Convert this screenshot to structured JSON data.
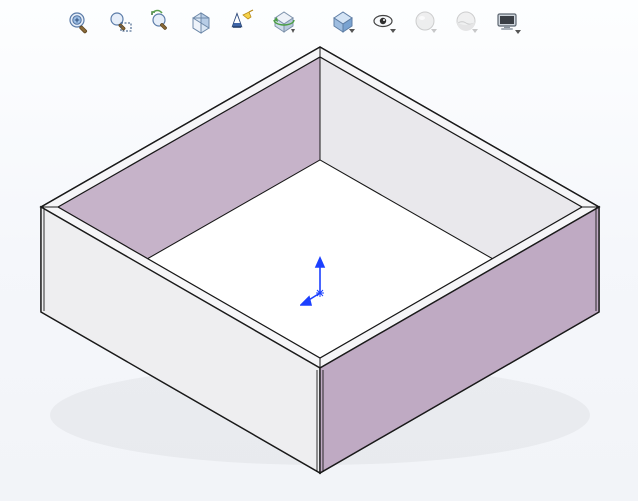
{
  "app": "CAD Viewer",
  "toolbar": {
    "items": [
      {
        "name": "zoom-to-fit-icon",
        "interactable": true,
        "tip": "Zoom to Fit"
      },
      {
        "name": "zoom-to-area-icon",
        "interactable": true,
        "tip": "Zoom to Area"
      },
      {
        "name": "previous-view-icon",
        "interactable": true,
        "tip": "Previous View"
      },
      {
        "name": "section-view-icon",
        "interactable": true,
        "tip": "Section View"
      },
      {
        "name": "dynamic-annotation-views-icon",
        "interactable": true,
        "tip": "Dynamic Annotation Views"
      },
      {
        "name": "view-orientation-icon",
        "interactable": true,
        "tip": "View Orientation"
      },
      {
        "name": "display-style-icon",
        "interactable": true,
        "tip": "Display Style"
      },
      {
        "name": "hide-show-items-icon",
        "interactable": true,
        "tip": "Hide/Show Items"
      },
      {
        "name": "edit-appearance-icon",
        "interactable": false,
        "tip": "Edit Appearance"
      },
      {
        "name": "apply-scene-icon",
        "interactable": false,
        "tip": "Apply Scene"
      },
      {
        "name": "view-settings-icon",
        "interactable": true,
        "tip": "View Settings"
      }
    ]
  },
  "colors": {
    "purple_face": "#c4b1c7",
    "purple_face_dk": "#b9a5bd",
    "light_face": "#f2f2f4",
    "light_face_b": "#e9eaee",
    "floor": "#fefefe",
    "edge": "#1a1a1a",
    "triad_blue": "#1c40ff"
  },
  "model": {
    "type": "open-box",
    "origin_shown": true
  }
}
